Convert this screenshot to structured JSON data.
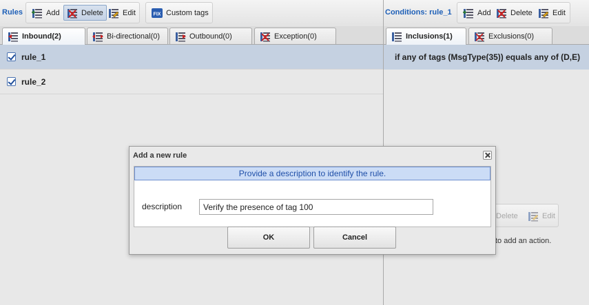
{
  "rules_toolbar": {
    "title": "Rules",
    "add_label": "Add",
    "delete_label": "Delete",
    "edit_label": "Edit",
    "custom_tags_label": "Custom tags",
    "fix_icon_text": "FIX"
  },
  "conditions_toolbar": {
    "title": "Conditions: rule_1",
    "add_label": "Add",
    "delete_label": "Delete",
    "edit_label": "Edit"
  },
  "rule_tabs": [
    {
      "label": "Inbound(2)",
      "active": true
    },
    {
      "label": "Bi-directional(0)",
      "active": false
    },
    {
      "label": "Outbound(0)",
      "active": false
    },
    {
      "label": "Exception(0)",
      "active": false
    }
  ],
  "condition_tabs": [
    {
      "label": "Inclusions(1)",
      "active": true
    },
    {
      "label": "Exclusions(0)",
      "active": false
    }
  ],
  "rules": [
    {
      "name": "rule_1",
      "checked": true,
      "selected": true
    },
    {
      "name": "rule_2",
      "checked": true,
      "selected": false
    }
  ],
  "conditions": [
    {
      "text": "if any of tags (MsgType(35)) equals any of (D,E)"
    }
  ],
  "actions_toolbar": {
    "delete_label": "Delete",
    "edit_label": "Edit",
    "hint_text": "to add an action."
  },
  "dialog": {
    "title": "Add a new rule",
    "info": "Provide a description to identify the rule.",
    "field_label": "description",
    "field_value": "Verify the presence of tag 100",
    "ok_label": "OK",
    "cancel_label": "Cancel"
  },
  "colors": {
    "accent_blue": "#1d5fb7",
    "selection": "#c5d1e1",
    "info_bg": "#cbdcf6",
    "delete_red": "#cc2222"
  }
}
